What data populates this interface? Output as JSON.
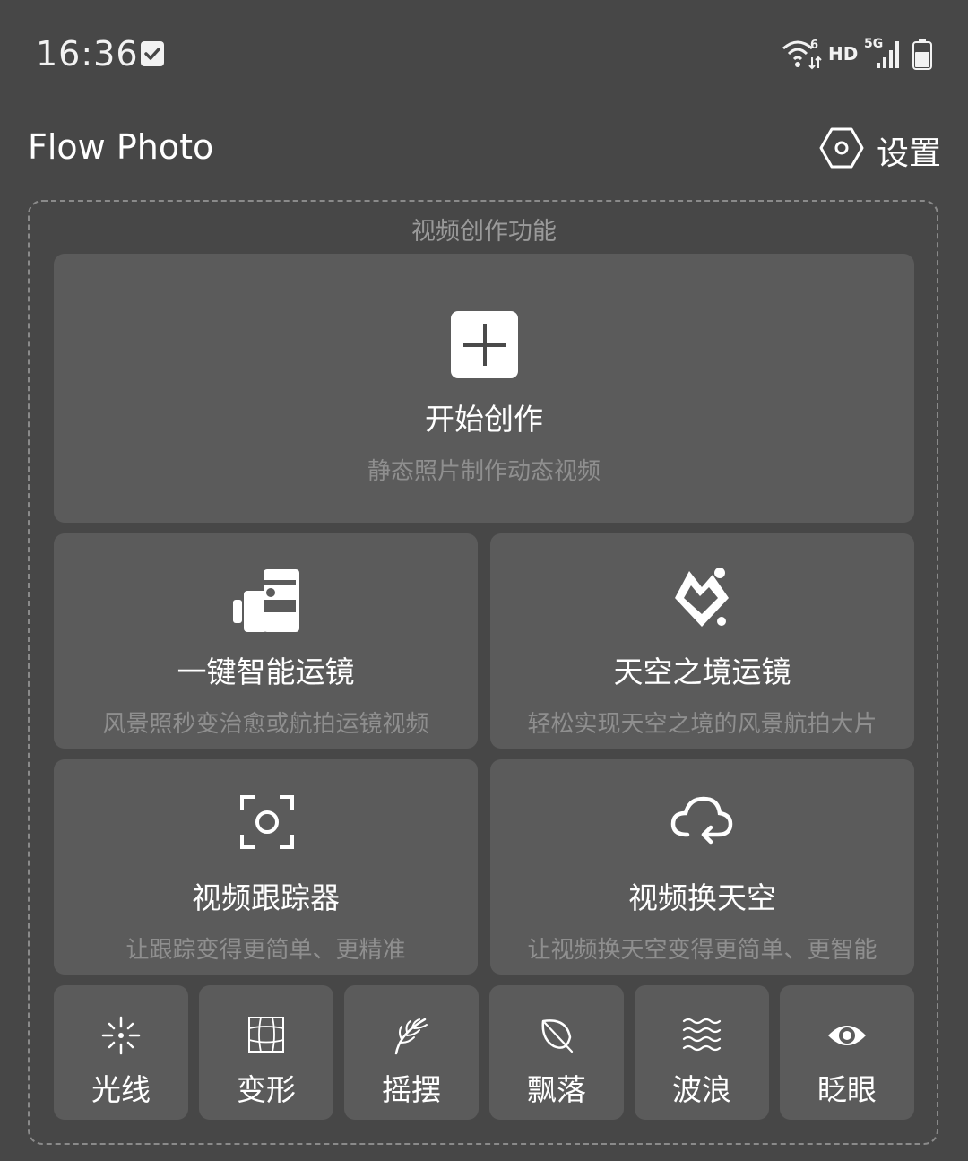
{
  "status_bar": {
    "time": "16:36",
    "network_label": "HD",
    "signal_label": "5G",
    "wifi_label": "6"
  },
  "header": {
    "title": "Flow Photo",
    "settings_label": "设置"
  },
  "panel": {
    "title": "视频创作功能"
  },
  "start_card": {
    "title": "开始创作",
    "subtitle": "静态照片制作动态视频",
    "icon": "plus-icon"
  },
  "feature_cards": [
    {
      "title": "一键智能运镜",
      "subtitle": "风景照秒变治愈或航拍运镜视频",
      "icon": "video-camera-icon"
    },
    {
      "title": "天空之境运镜",
      "subtitle": "轻松实现天空之境的风景航拍大片",
      "icon": "sky-mirror-icon"
    },
    {
      "title": "视频跟踪器",
      "subtitle": "让跟踪变得更简单、更精准",
      "icon": "focus-tracker-icon"
    },
    {
      "title": "视频换天空",
      "subtitle": "让视频换天空变得更简单、更智能",
      "icon": "cloud-replace-icon"
    }
  ],
  "tools": [
    {
      "label": "光线",
      "icon": "light-rays-icon"
    },
    {
      "label": "变形",
      "icon": "warp-grid-icon"
    },
    {
      "label": "摇摆",
      "icon": "branch-sway-icon"
    },
    {
      "label": "飘落",
      "icon": "falling-leaf-icon"
    },
    {
      "label": "波浪",
      "icon": "waves-icon"
    },
    {
      "label": "眨眼",
      "icon": "eye-blink-icon"
    }
  ],
  "colors": {
    "background": "#474747",
    "card": "#5b5b5b",
    "subtitle": "#8f8f8f",
    "panel_border": "#8a8a8a"
  }
}
